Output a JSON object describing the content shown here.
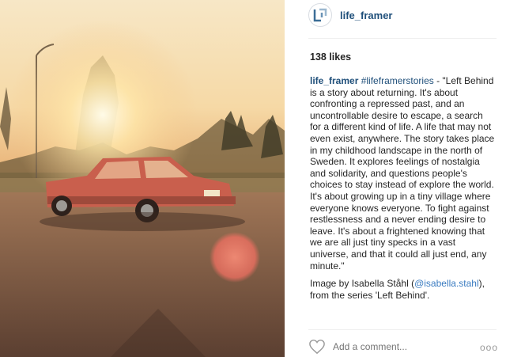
{
  "post": {
    "photo_description_icon": "vintage-car-sunset-photo",
    "username": "life_framer",
    "likes": "138 likes",
    "caption_user": "life_framer",
    "caption_tag": "#lifeframerstories",
    "caption_text": " - \"Left Behind is a story about returning. It's about confronting a repressed past, and an uncontrollable desire to escape, a search for a different kind of life. A life that may not even exist, anywhere. The story takes place in my childhood landscape in the north of Sweden. It explores feelings of nostalgia and solidarity, and questions people's choices to stay instead of explore the world. It's about growing up in a tiny village where everyone knows everyone. To fight against restlessness and a never ending desire to leave. It's about a frightened knowing that we are all just tiny specks in a vast universe, and that it could all just end, any minute.\"",
    "credit_prefix": "Image by  Isabella Ståhl (",
    "credit_handle": "@isabella.stahl",
    "credit_suffix": "), from the  series 'Left Behind'.",
    "comment_placeholder": "Add a comment...",
    "more_label": "ooo"
  },
  "colors": {
    "username": "#1f4f7a",
    "handle": "#3b7cc1",
    "car": "#c95f4d"
  }
}
